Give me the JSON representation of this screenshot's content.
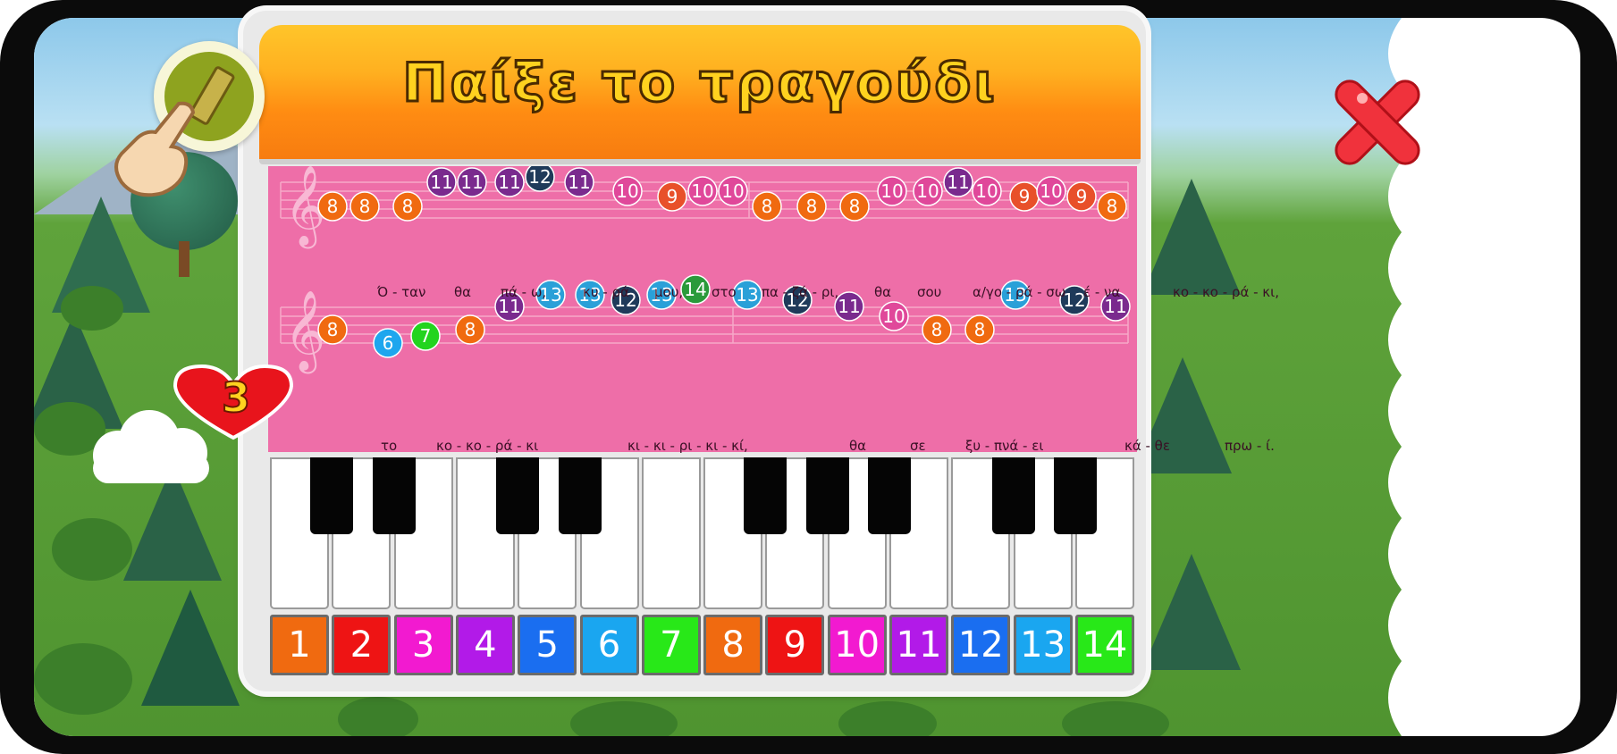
{
  "title": "Παίξε το τραγούδι",
  "lives": "3",
  "icons": {
    "eraser": "eraser-icon",
    "hand": "pointing-hand-icon",
    "close": "close-icon",
    "heart": "heart-icon"
  },
  "colors": {
    "sheet": "#ee6ea8",
    "title_orange": "#ff8c12",
    "title_text": "#ffd21f"
  },
  "note_colors": {
    "6": "#1ea6ee",
    "7": "#22d41e",
    "8": "#f06a10",
    "9": "#e8502a",
    "10": "#e0489a",
    "11": "#7a2a8e",
    "12": "#1f3a5a",
    "13": "#2aa0d8",
    "14": "#2a9a3a"
  },
  "staff1": {
    "notes": [
      8,
      8,
      8,
      11,
      11,
      11,
      12,
      11,
      10,
      9,
      10,
      10,
      8,
      8,
      8,
      10,
      10,
      11,
      10,
      9,
      10,
      9,
      8
    ],
    "lyrics": [
      "Ό - ταν",
      "θα",
      "πά - ω,",
      "κυ - ρά",
      "μου,",
      "στο",
      "πα - ζά - ρι,",
      "θα",
      "σου",
      "α/γο - ρά - σω",
      "έ - να",
      "κο - κο - ρά - κι,"
    ]
  },
  "staff2": {
    "notes": [
      8,
      6,
      7,
      8,
      11,
      13,
      13,
      12,
      13,
      14,
      13,
      12,
      11,
      10,
      8,
      8,
      13,
      12,
      11
    ],
    "lyrics": [
      "το",
      "κο - κο - ρά - κι",
      "κι - κι - ρι - κι - κί,",
      "θα",
      "σε",
      "ξυ - πνά - ει",
      "κά - θε",
      "πρω - ί."
    ]
  },
  "keys": [
    {
      "label": "1",
      "color": "#f06a10"
    },
    {
      "label": "2",
      "color": "#ee1414"
    },
    {
      "label": "3",
      "color": "#f21ad0"
    },
    {
      "label": "4",
      "color": "#b21ae8"
    },
    {
      "label": "5",
      "color": "#1a6ef0"
    },
    {
      "label": "6",
      "color": "#1aa6f0"
    },
    {
      "label": "7",
      "color": "#28e818"
    },
    {
      "label": "8",
      "color": "#f06a10"
    },
    {
      "label": "9",
      "color": "#ee1414"
    },
    {
      "label": "10",
      "color": "#f21ad0"
    },
    {
      "label": "11",
      "color": "#b21ae8"
    },
    {
      "label": "12",
      "color": "#1a6ef0"
    },
    {
      "label": "13",
      "color": "#1aa6f0"
    },
    {
      "label": "14",
      "color": "#28e818"
    }
  ]
}
